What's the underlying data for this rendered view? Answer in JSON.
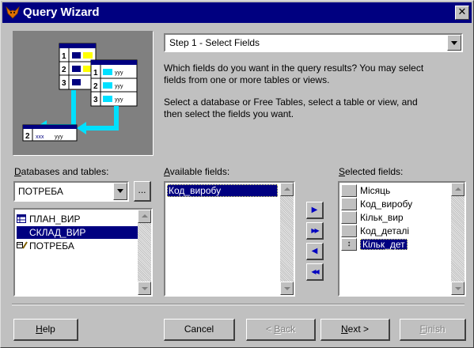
{
  "window": {
    "title": "Query Wizard",
    "close_glyph": "✕"
  },
  "step_selector": {
    "selected": "Step 1 - Select Fields"
  },
  "description": {
    "line1": "Which fields do you want in the query results? You may select",
    "line2": "fields from one or more tables or views.",
    "line3": "Select a database or Free Tables, select a table or view, and",
    "line4": "then select the fields you want."
  },
  "illustration": {
    "rows_left": [
      "1",
      "2",
      "3"
    ],
    "rows_right": [
      "1",
      "2",
      "3"
    ],
    "bottom_row": "2",
    "cell_x": "xxx",
    "cell_y": "yyy"
  },
  "databases": {
    "label_prefix": "D",
    "label_rest": "atabases and tables:",
    "combo_value": "ПОТРЕБА",
    "browse_label": "...",
    "items": [
      {
        "label": "ПЛАН_ВИР",
        "icon": "table-icon"
      },
      {
        "label": "СКЛАД_ВИР",
        "icon": "table-icon"
      },
      {
        "label": "ПОТРЕБА",
        "icon": "database-icon"
      }
    ]
  },
  "available_fields": {
    "label_prefix": "A",
    "label_rest": "vailable fields:",
    "items": [
      "Код_виробу"
    ]
  },
  "selected_fields": {
    "label_prefix": "S",
    "label_rest": "elected fields:",
    "items": [
      "Місяць",
      "Код_виробу",
      "Кільк_вир",
      "Код_деталі",
      "Кільк_дет"
    ],
    "active_marker": "↕"
  },
  "move_buttons": [
    {
      "glyph": "▶",
      "action": "add"
    },
    {
      "glyph": "▶▶",
      "action": "add-all"
    },
    {
      "glyph": "◀",
      "action": "remove"
    },
    {
      "glyph": "◀◀",
      "action": "remove-all"
    }
  ],
  "footer": {
    "help_prefix": "H",
    "help_rest": "elp",
    "cancel": "Cancel",
    "back_prefix": "< ",
    "back_ul": "B",
    "back_rest": "ack",
    "next_ul": "N",
    "next_rest": "ext >",
    "finish_ul": "F",
    "finish_rest": "inish"
  },
  "colors": {
    "title_bar": "#000080",
    "dialog_face": "#c0c0c0",
    "selection": "#000080",
    "illustration_bg": "#808080",
    "arrow_cyan": "#00e0ff"
  }
}
